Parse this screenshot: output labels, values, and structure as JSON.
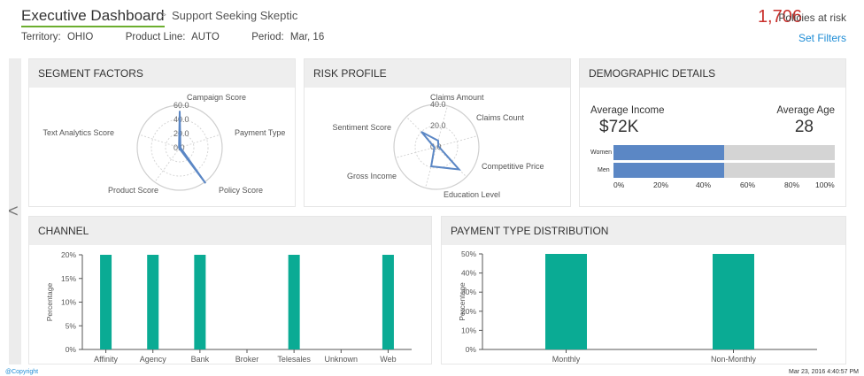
{
  "header": {
    "title": "Executive Dashboard",
    "separator": ">",
    "subtitle": "Support Seeking Skeptic",
    "territory_label": "Territory:",
    "territory_value": "OHIO",
    "product_label": "Product Line:",
    "product_value": "AUTO",
    "period_label": "Period:",
    "period_value": "Mar, 16",
    "risk_count": "1,706",
    "risk_label": "Policies at risk",
    "set_filters": "Set Filters"
  },
  "nav": {
    "prev": "<"
  },
  "panels": {
    "segment": "SEGMENT FACTORS",
    "risk": "RISK PROFILE",
    "demographic": "DEMOGRAPHIC DETAILS",
    "channel": "CHANNEL",
    "payment": "PAYMENT TYPE DISTRIBUTION"
  },
  "demographic": {
    "income_label": "Average Income",
    "income_value": "$72K",
    "age_label": "Average Age",
    "age_value": "28",
    "bars": [
      {
        "label": "Women",
        "value": 0.5
      },
      {
        "label": "Men",
        "value": 0.5
      }
    ],
    "ticks": [
      "0%",
      "20%",
      "40%",
      "60%",
      "80%",
      "100%"
    ],
    "colors": {
      "fill": "#5b87c5",
      "track": "#d4d4d4"
    }
  },
  "footer": {
    "copyright": "@Copyright",
    "timestamp": "Mar 23, 2016  4:40:57 PM"
  },
  "chart_data": [
    {
      "type": "radar",
      "axes": [
        "Campaign Score",
        "Payment Type",
        "Policy Score",
        "Product Score",
        "Text Analytics Score"
      ],
      "radial_ticks": [
        "0.0",
        "20.0",
        "40.0",
        "60.0"
      ],
      "rlim": [
        0,
        60
      ],
      "values": [
        52,
        1,
        62,
        1,
        1
      ]
    },
    {
      "type": "radar",
      "axes": [
        "Claims Amount",
        "Claims Count",
        "Competitive Price",
        "Education Level",
        "Gross Income",
        "Sentiment Score"
      ],
      "radial_ticks": [
        "0.0",
        "20.0",
        "40.0"
      ],
      "rlim": [
        0,
        40
      ],
      "values": [
        6,
        2,
        30,
        19,
        2,
        20
      ]
    },
    {
      "type": "bar",
      "categories": [
        "Affinity",
        "Agency",
        "Bank",
        "Broker",
        "Telesales",
        "Unknown",
        "Web"
      ],
      "values": [
        20,
        20,
        20,
        0,
        20,
        0,
        20
      ],
      "ylabel": "Percentage",
      "ylim": [
        0,
        20
      ],
      "yticks": [
        "0%",
        "5%",
        "10%",
        "15%",
        "20%"
      ],
      "color": "#0aab94"
    },
    {
      "type": "bar",
      "categories": [
        "Monthly",
        "Non-Monthly"
      ],
      "values": [
        50,
        50
      ],
      "ylabel": "Percentage",
      "ylim": [
        0,
        50
      ],
      "yticks": [
        "0%",
        "10%",
        "20%",
        "30%",
        "40%",
        "50%"
      ],
      "color": "#0aab94"
    }
  ]
}
